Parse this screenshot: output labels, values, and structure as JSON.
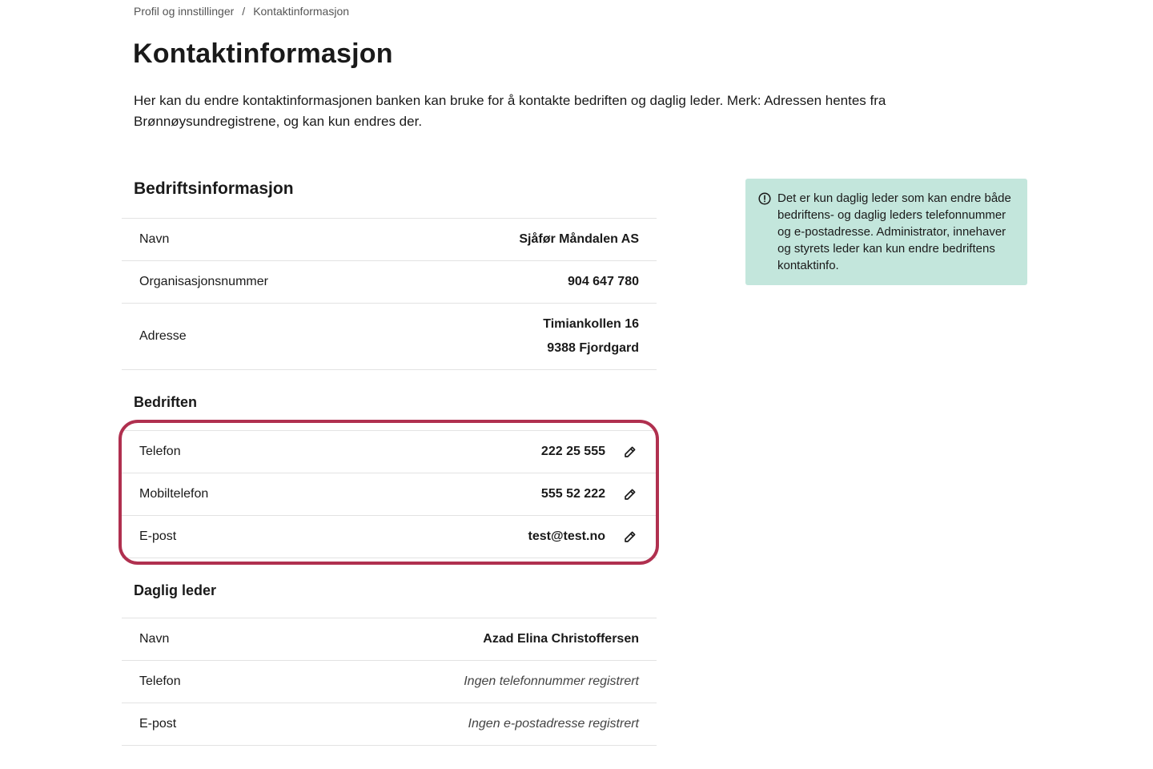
{
  "breadcrumb": {
    "parent": "Profil og innstillinger",
    "separator": "/",
    "current": "Kontaktinformasjon"
  },
  "page": {
    "title": "Kontaktinformasjon",
    "intro": "Her kan du endre kontaktinformasjonen banken kan bruke for å kontakte bedriften og daglig leder. Merk: Adressen hentes fra Brønnøysundregistrene, og kan kun endres der."
  },
  "company_info": {
    "title": "Bedriftsinformasjon",
    "name_label": "Navn",
    "name_value": "Sjåfør Måndalen AS",
    "orgnr_label": "Organisasjonsnummer",
    "orgnr_value": "904 647 780",
    "address_label": "Adresse",
    "address_line1": "Timiankollen 16",
    "address_line2": "9388 Fjordgard"
  },
  "company_contact": {
    "title": "Bedriften",
    "phone_label": "Telefon",
    "phone_value": "222 25 555",
    "mobile_label": "Mobiltelefon",
    "mobile_value": "555 52 222",
    "email_label": "E-post",
    "email_value": "test@test.no",
    "edit_icon": "pencil-icon"
  },
  "manager": {
    "title": "Daglig leder",
    "name_label": "Navn",
    "name_value": "Azad Elina Christoffersen",
    "phone_label": "Telefon",
    "phone_value": "Ingen telefonnummer registrert",
    "email_label": "E-post",
    "email_value": "Ingen e-postadresse registrert"
  },
  "info_box": {
    "icon": "info-circle-icon",
    "text": "Det er kun daglig leder som kan endre både bedriftens- og daglig leders telefonnummer og e-postadresse. Administrator, innehaver og styrets leder kan kun endre bedriftens kontaktinfo."
  },
  "colors": {
    "highlight_border": "#b0304f",
    "info_box_bg": "#c3e6dc"
  }
}
